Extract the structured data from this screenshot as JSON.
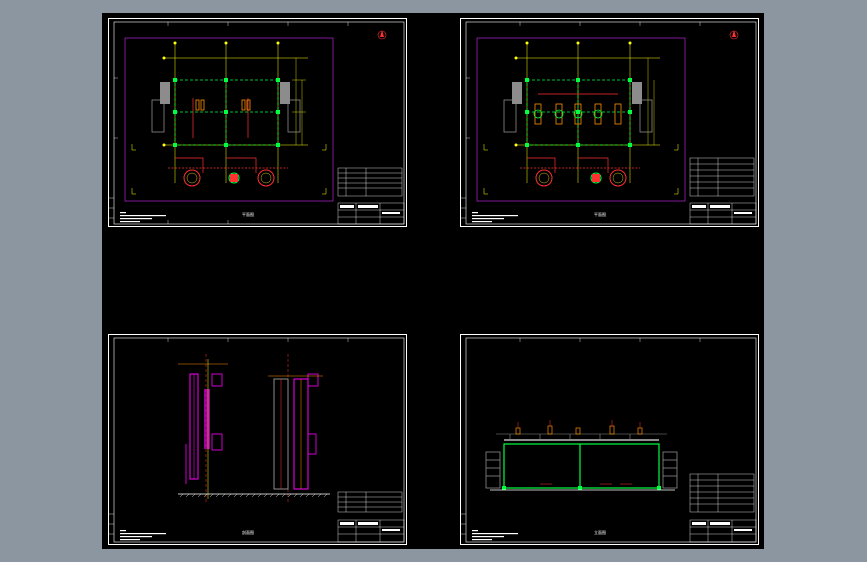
{
  "window": {
    "background": "#8c96a0",
    "canvas_color": "#000000"
  },
  "colors": {
    "frame": "#ffffff",
    "border_magenta": "#a020c0",
    "grid_green": "#00ff40",
    "axis_yellow": "#ffff00",
    "pipe_red": "#ff3030",
    "equip_magenta": "#ff00ff",
    "equip_gray": "#8c8c8c",
    "accent_orange": "#ff9000"
  },
  "sheets": [
    {
      "name": "plan-view-1",
      "title": "平面图"
    },
    {
      "name": "plan-view-2",
      "title": "平面图"
    },
    {
      "name": "section-view",
      "title": "剖面图"
    },
    {
      "name": "elevation-view",
      "title": "立面图"
    }
  ],
  "icons": {
    "north_arrow": "north-arrow-icon"
  }
}
